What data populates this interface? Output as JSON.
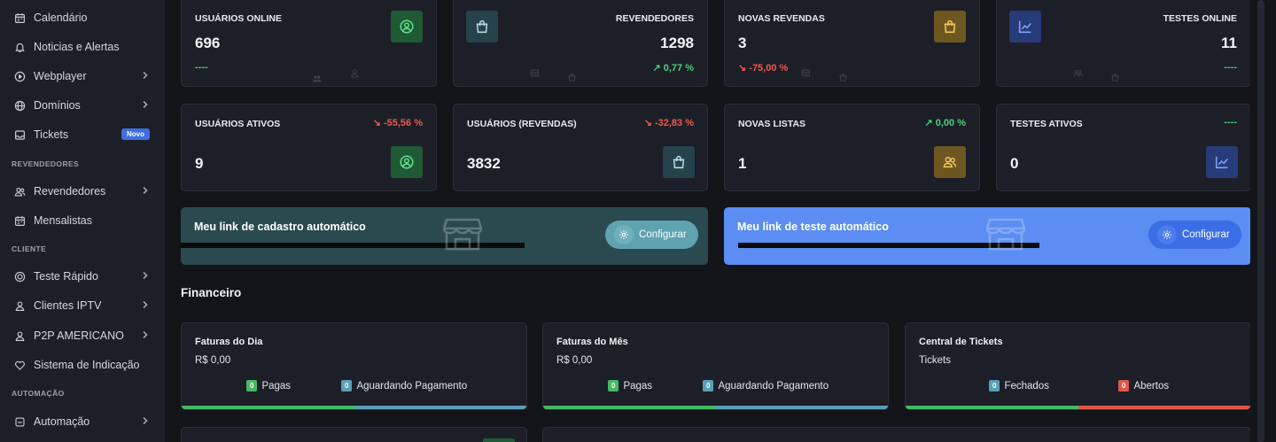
{
  "sidebar": {
    "items": [
      {
        "id": "calendario",
        "label": "Calendário",
        "icon": "calendar-icon",
        "chevron": false
      },
      {
        "id": "noticias",
        "label": "Noticias e Alertas",
        "icon": "bell-icon",
        "chevron": false
      },
      {
        "id": "webplayer",
        "label": "Webplayer",
        "icon": "play-circle-icon",
        "chevron": true
      },
      {
        "id": "dominios",
        "label": "Domínios",
        "icon": "globe-icon",
        "chevron": true
      },
      {
        "id": "tickets",
        "label": "Tickets",
        "icon": "inbox-icon",
        "chevron": false,
        "badge": "Novo"
      },
      {
        "id": "revendedores",
        "label": "Revendedores",
        "icon": "users-icon",
        "chevron": true
      },
      {
        "id": "mensalistas",
        "label": "Mensalistas",
        "icon": "calendar-grid-icon",
        "chevron": false
      },
      {
        "id": "teste-rapido",
        "label": "Teste Rápido",
        "icon": "smile-circle-icon",
        "chevron": true
      },
      {
        "id": "clientes-iptv",
        "label": "Clientes IPTV",
        "icon": "user-icon",
        "chevron": true
      },
      {
        "id": "p2p-americano",
        "label": "P2P AMERICANO",
        "icon": "user-icon",
        "chevron": true
      },
      {
        "id": "sistema-indicacao",
        "label": "Sistema de Indicação",
        "icon": "heart-icon",
        "chevron": false
      },
      {
        "id": "automacao",
        "label": "Automação",
        "icon": "square-icon",
        "chevron": true
      }
    ],
    "sections": {
      "revendedores": "REVENDEDORES",
      "cliente": "CLIENTE",
      "automacao": "AUTOMAÇÃO"
    }
  },
  "stats": {
    "usuarios_online": {
      "title": "USUÁRIOS ONLINE",
      "value": "696",
      "trend": "----"
    },
    "revendedores": {
      "title": "REVENDEDORES",
      "value": "1298",
      "trend": "0,77 %"
    },
    "novas_revendas": {
      "title": "NOVAS REVENDAS",
      "value": "3",
      "trend": "-75,00 %"
    },
    "testes_online": {
      "title": "TESTES ONLINE",
      "value": "11",
      "trend": "----"
    },
    "usuarios_ativos": {
      "title": "USUÁRIOS ATIVOS",
      "value": "9",
      "trend": "-55,56 %"
    },
    "usuarios_revendas": {
      "title": "USUÁRIOS (REVENDAS)",
      "value": "3832",
      "trend": "-32,83 %"
    },
    "novas_listas": {
      "title": "NOVAS LISTAS",
      "value": "1",
      "trend": "0,00 %"
    },
    "testes_ativos": {
      "title": "TESTES ATIVOS",
      "value": "0",
      "trend": "----"
    }
  },
  "links": {
    "cadastro": {
      "title": "Meu link de cadastro automático",
      "button": "Configurar",
      "color": "#2b4a4f"
    },
    "teste": {
      "title": "Meu link de teste automático",
      "button": "Configurar",
      "color": "#5b8df2"
    }
  },
  "financeiro": {
    "title": "Financeiro",
    "cards": [
      {
        "title": "Faturas do Dia",
        "sub": "R$ 0,00",
        "a_count": "0",
        "a_label": "Pagas",
        "b_count": "0",
        "b_label": "Aguardando Pagamento"
      },
      {
        "title": "Faturas do Mês",
        "sub": "R$ 0,00",
        "a_count": "0",
        "a_label": "Pagas",
        "b_count": "0",
        "b_label": "Aguardando Pagamento"
      },
      {
        "title": "Central de Tickets",
        "sub": "Tickets",
        "a_count": "0",
        "a_label": "Fechados",
        "b_count": "0",
        "b_label": "Abertos"
      }
    ]
  },
  "colors": {
    "green": "#4cd07a",
    "red": "#f0584c",
    "accent": "#3d6fe0"
  }
}
